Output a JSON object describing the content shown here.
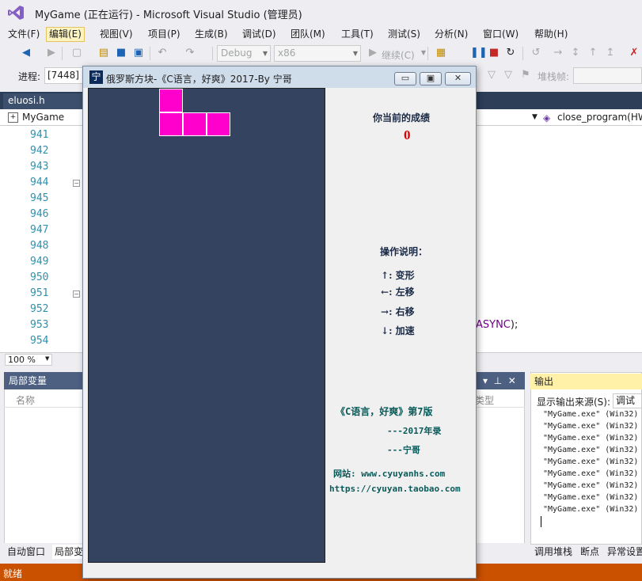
{
  "vs": {
    "title": "MyGame (正在运行) - Microsoft Visual Studio (管理员)",
    "menu": [
      "文件(F)",
      "编辑(E)",
      "视图(V)",
      "项目(P)",
      "生成(B)",
      "调试(D)",
      "团队(M)",
      "工具(T)",
      "测试(S)",
      "分析(N)",
      "窗口(W)",
      "帮助(H)"
    ],
    "toolbar": {
      "config": "Debug",
      "platform": "x86",
      "continue_label": "继续(C)"
    },
    "debugbar": {
      "process_label": "进程:",
      "process_value": "[7448] M",
      "stackframe_label": "堆栈帧:"
    },
    "editor": {
      "tab": "eluosi.h",
      "nav_project": "MyGame",
      "nav_function": "close_program(HW",
      "line_numbers": [
        "941",
        "942",
        "943",
        "944",
        "945",
        "946",
        "947",
        "948",
        "949",
        "950",
        "951",
        "952",
        "953",
        "954"
      ],
      "code_fragment_kw": "ASYNC",
      "code_fragment_rest": ");",
      "zoom": "100 %"
    },
    "locals": {
      "title": "局部变量",
      "col_name": "名称",
      "col_type": "类型"
    },
    "bottom_tabs": [
      "自动窗口",
      "局部变"
    ],
    "output": {
      "title": "输出",
      "source_label": "显示输出来源(S):",
      "source_value": "调试",
      "lines": [
        "\"MyGame.exe\" (Win32)",
        "\"MyGame.exe\" (Win32)",
        "\"MyGame.exe\" (Win32)",
        "\"MyGame.exe\" (Win32)",
        "\"MyGame.exe\" (Win32)",
        "\"MyGame.exe\" (Win32)",
        "\"MyGame.exe\" (Win32)",
        "\"MyGame.exe\" (Win32)",
        "\"MyGame.exe\" (Win32)"
      ],
      "tabs": [
        "调用堆栈",
        "断点",
        "异常设置"
      ]
    },
    "status": "就绪"
  },
  "game": {
    "icon_char": "宁",
    "title": "俄罗斯方块-《C语言，好爽》2017-By 宁哥",
    "score_label": "你当前的成绩",
    "score": "0",
    "help_title": "操作说明：",
    "controls": [
      {
        "key": "↑",
        "action": "变形"
      },
      {
        "key": "←",
        "action": "左移"
      },
      {
        "key": "→",
        "action": "右移"
      },
      {
        "key": "↓",
        "action": "加速"
      }
    ],
    "book": "《C语言，好爽》第7版",
    "credit_year": "---2017年录",
    "credit_author": "---宁哥",
    "site_label": "网站:",
    "site": "www.cyuyanhs.com",
    "shop": "https://cyuyan.taobao.com",
    "piece_color": "#ff00cc",
    "playfield_color": "#34435f"
  }
}
